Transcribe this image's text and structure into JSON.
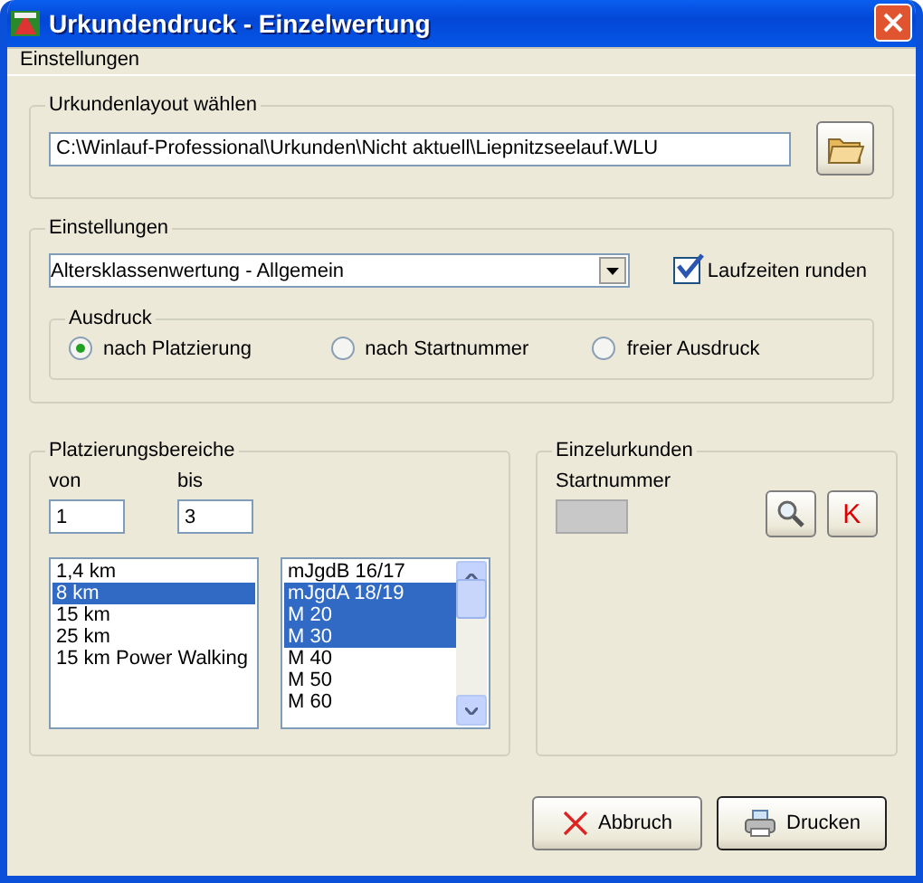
{
  "window": {
    "title": "Urkundendruck - Einzelwertung"
  },
  "menu": [
    "Einstellungen"
  ],
  "layout_group": {
    "label": "Urkundenlayout wählen",
    "path": "C:\\Winlauf-Professional\\Urkunden\\Nicht aktuell\\Liepnitzseelauf.WLU"
  },
  "settings_group": {
    "label": "Einstellungen",
    "mode": "Altersklassenwertung - Allgemein",
    "round_times": {
      "label": "Laufzeiten runden",
      "checked": true
    },
    "print_group": {
      "label": "Ausdruck",
      "options": [
        {
          "label": "nach Platzierung",
          "selected": true
        },
        {
          "label": "nach Startnummer",
          "selected": false
        },
        {
          "label": "freier Ausdruck",
          "selected": false
        }
      ]
    }
  },
  "ranges_group": {
    "label": "Platzierungsbereiche",
    "from_label": "von",
    "from": "1",
    "to_label": "bis",
    "to": "3",
    "distances": [
      {
        "label": "1,4 km",
        "selected": false
      },
      {
        "label": "8 km",
        "selected": true
      },
      {
        "label": "15 km",
        "selected": false
      },
      {
        "label": "25 km",
        "selected": false
      },
      {
        "label": "15 km Power Walking",
        "selected": false
      }
    ],
    "classes": [
      {
        "label": "mJgdB 16/17",
        "selected": false
      },
      {
        "label": "mJgdA 18/19",
        "selected": true
      },
      {
        "label": "M 20",
        "selected": true
      },
      {
        "label": "M 30",
        "selected": true
      },
      {
        "label": "M 40",
        "selected": false
      },
      {
        "label": "M 50",
        "selected": false
      },
      {
        "label": "M 60",
        "selected": false
      }
    ]
  },
  "single_group": {
    "label": "Einzelurkunden",
    "number_label": "Startnummer",
    "k_button": "K"
  },
  "buttons": [
    {
      "kind": "cancel",
      "label": "Abbruch"
    },
    {
      "kind": "print",
      "label": "Drucken"
    }
  ]
}
